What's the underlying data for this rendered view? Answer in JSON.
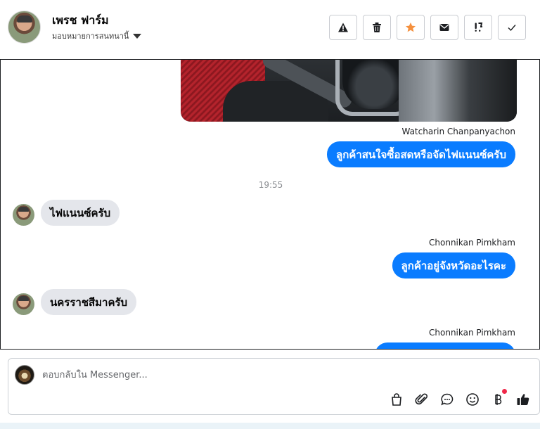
{
  "header": {
    "contact_name": "เพรช ฟาร์ม",
    "assign_label": "มอบหมายการสนทนานี้"
  },
  "toolbar": {
    "buttons": [
      {
        "icon": "warning-icon",
        "action": "report-spam"
      },
      {
        "icon": "trash-icon",
        "action": "delete"
      },
      {
        "icon": "star-icon",
        "action": "star",
        "color": "#f5903d"
      },
      {
        "icon": "envelope-icon",
        "action": "mark-unread"
      },
      {
        "icon": "follow-up-icon",
        "action": "follow-up"
      },
      {
        "icon": "check-icon",
        "action": "mark-done"
      }
    ]
  },
  "messages": [
    {
      "kind": "image",
      "direction": "out"
    },
    {
      "kind": "text",
      "direction": "out",
      "sender": "Watcharin Chanpanyachon",
      "text": "ลูกค้าสนใจซื้อสดหรือจัดไฟแนนซ์ครับ"
    },
    {
      "kind": "time",
      "text": "19:55"
    },
    {
      "kind": "text",
      "direction": "in",
      "text": "ไฟแนนซ์ครับ"
    },
    {
      "kind": "text",
      "direction": "out",
      "sender": "Chonnikan Pimkham",
      "text": "ลูกค้าอยู่จังหวัดอะไรคะ"
    },
    {
      "kind": "text",
      "direction": "in",
      "text": "นครราชสีมาครับ"
    },
    {
      "kind": "text",
      "direction": "out",
      "sender": "Chonnikan Pimkham",
      "text": ""
    }
  ],
  "composer": {
    "placeholder": "ตอบกลับใน Messenger...",
    "icons": [
      "shopping-bag-icon",
      "paperclip-icon",
      "saved-reply-icon",
      "emoji-icon",
      "baht-icon",
      "thumbs-up-icon"
    ],
    "accent_color": "#0a7cff",
    "notification_color": "#f02849"
  }
}
